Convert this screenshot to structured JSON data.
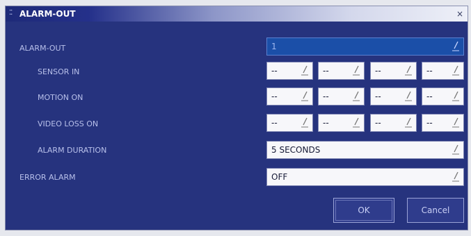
{
  "window": {
    "title": "ALARM-OUT",
    "close_glyph": "×",
    "title_icon": "dotted-grid-icon"
  },
  "rows": [
    {
      "label": "ALARM-OUT",
      "value": "1"
    },
    {
      "label": "SENSOR IN",
      "values": [
        "--",
        "--",
        "--",
        "--"
      ]
    },
    {
      "label": "MOTION ON",
      "values": [
        "--",
        "--",
        "--",
        "--"
      ]
    },
    {
      "label": "VIDEO LOSS ON",
      "values": [
        "--",
        "--",
        "--",
        "--"
      ]
    },
    {
      "label": "ALARM DURATION",
      "value": "5 SECONDS"
    },
    {
      "label": "ERROR ALARM",
      "value": "OFF"
    }
  ],
  "buttons": {
    "ok": "OK",
    "cancel": "Cancel"
  },
  "colors": {
    "background": "#26337e",
    "field": "#f7f7fa",
    "selected_field": "#1b4fa8",
    "label": "#b8c0ea"
  }
}
